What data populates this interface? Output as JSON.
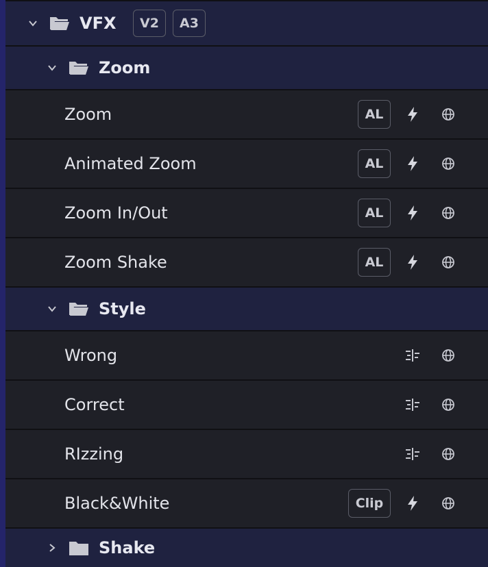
{
  "root": {
    "title": "VFX",
    "badges": [
      "V2",
      "A3"
    ]
  },
  "zoom_folder": {
    "title": "Zoom",
    "items": [
      {
        "label": "Zoom",
        "badge": "AL"
      },
      {
        "label": "Animated Zoom",
        "badge": "AL"
      },
      {
        "label": "Zoom In/Out",
        "badge": "AL"
      },
      {
        "label": "Zoom Shake",
        "badge": "AL"
      }
    ]
  },
  "style_folder": {
    "title": "Style",
    "items": [
      {
        "label": "Wrong"
      },
      {
        "label": "Correct"
      },
      {
        "label": "RIzzing"
      },
      {
        "label": "Black&White",
        "badge": "Clip"
      }
    ]
  },
  "shake_folder": {
    "title": "Shake"
  },
  "colors": {
    "folder_bg": "#1f2240",
    "item_bg": "#1f2027",
    "accent_bar": "#24246a"
  }
}
